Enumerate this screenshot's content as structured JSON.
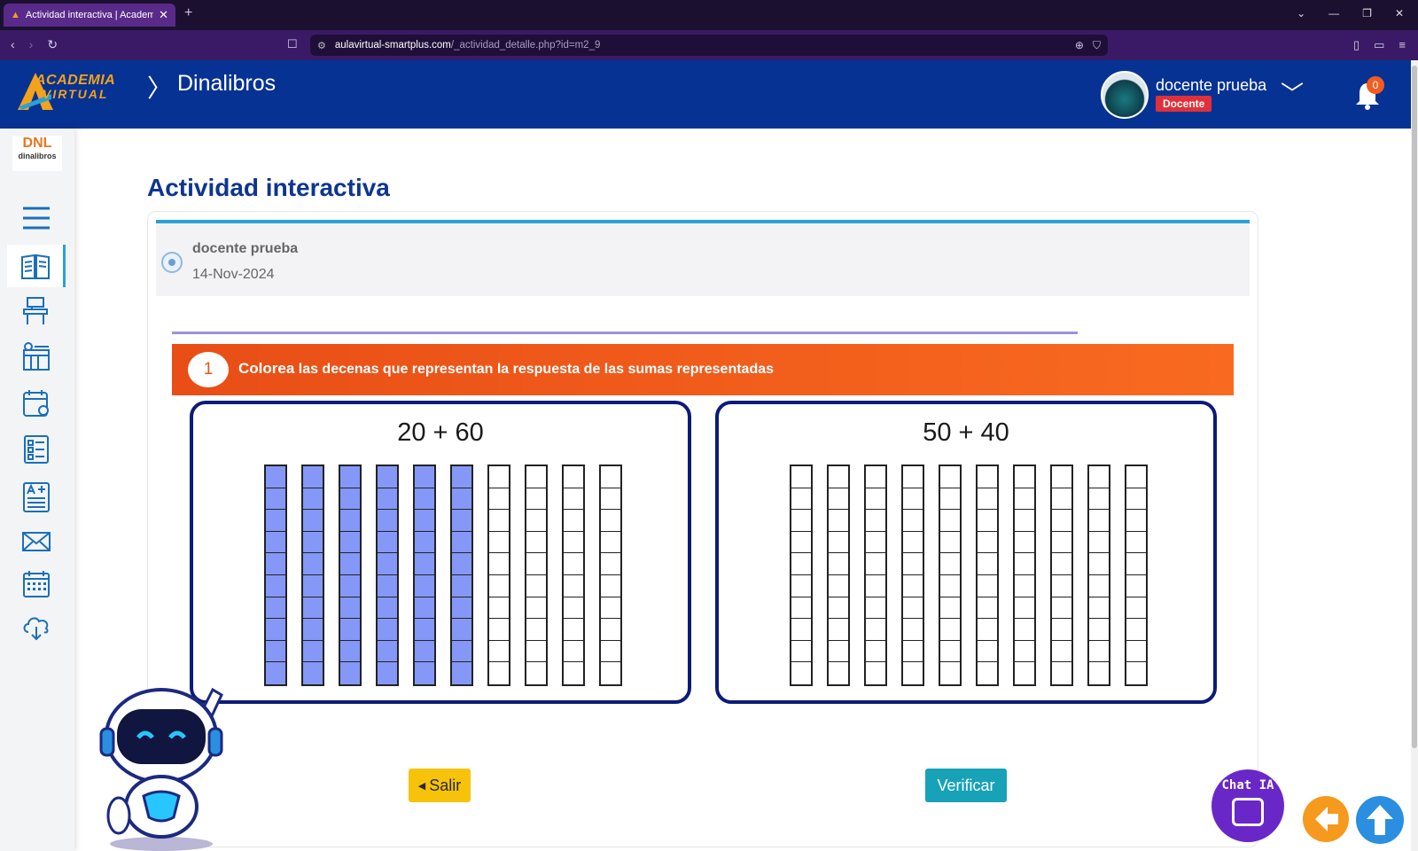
{
  "browser": {
    "tab_title": "Actividad interactiva | Academia",
    "tab_close": "✕",
    "new_tab": "+",
    "url_domain": "aulavirtual-smartplus.com",
    "url_path": "/_actividad_detalle.php?id=m2_9"
  },
  "header": {
    "logo_line1": "ACADEMIA",
    "logo_line2": "VIRTUAL",
    "breadcrumb": "Dinalibros",
    "user_name": "docente prueba",
    "user_role": "Docente",
    "notifications": "0"
  },
  "sidebar": {
    "logo_mark": "DNL",
    "logo_name": "dinalibros",
    "items": [
      {
        "name": "menu-icon"
      },
      {
        "name": "book-icon",
        "active": true
      },
      {
        "name": "school-desk-icon"
      },
      {
        "name": "schedule-icon"
      },
      {
        "name": "calendar-user-icon"
      },
      {
        "name": "checklist-icon"
      },
      {
        "name": "grades-icon"
      },
      {
        "name": "mail-icon"
      },
      {
        "name": "calendar-icon"
      },
      {
        "name": "cloud-download-icon"
      }
    ]
  },
  "main": {
    "page_title": "Actividad interactiva",
    "post_author": "docente prueba",
    "post_date": "14-Nov-2024",
    "exercise_number": "1",
    "instruction_bold": "Colorea",
    "instruction_rest": " las decenas que representan la respuesta de las sumas representadas",
    "panels": [
      {
        "title": "20 + 60",
        "filled_tens": 6,
        "total_tens": 10
      },
      {
        "title": "50 + 40",
        "filled_tens": 0,
        "total_tens": 10
      }
    ],
    "btn_exit": "Salir",
    "btn_verify": "Verificar"
  },
  "widgets": {
    "chat_label": "Chat IA"
  },
  "colors": {
    "header_bg": "#063294",
    "accent_blue": "#2aa0d8",
    "banner_orange": "#e84e16",
    "filled_ten": "#8598f7",
    "panel_border": "#0b1b78"
  }
}
